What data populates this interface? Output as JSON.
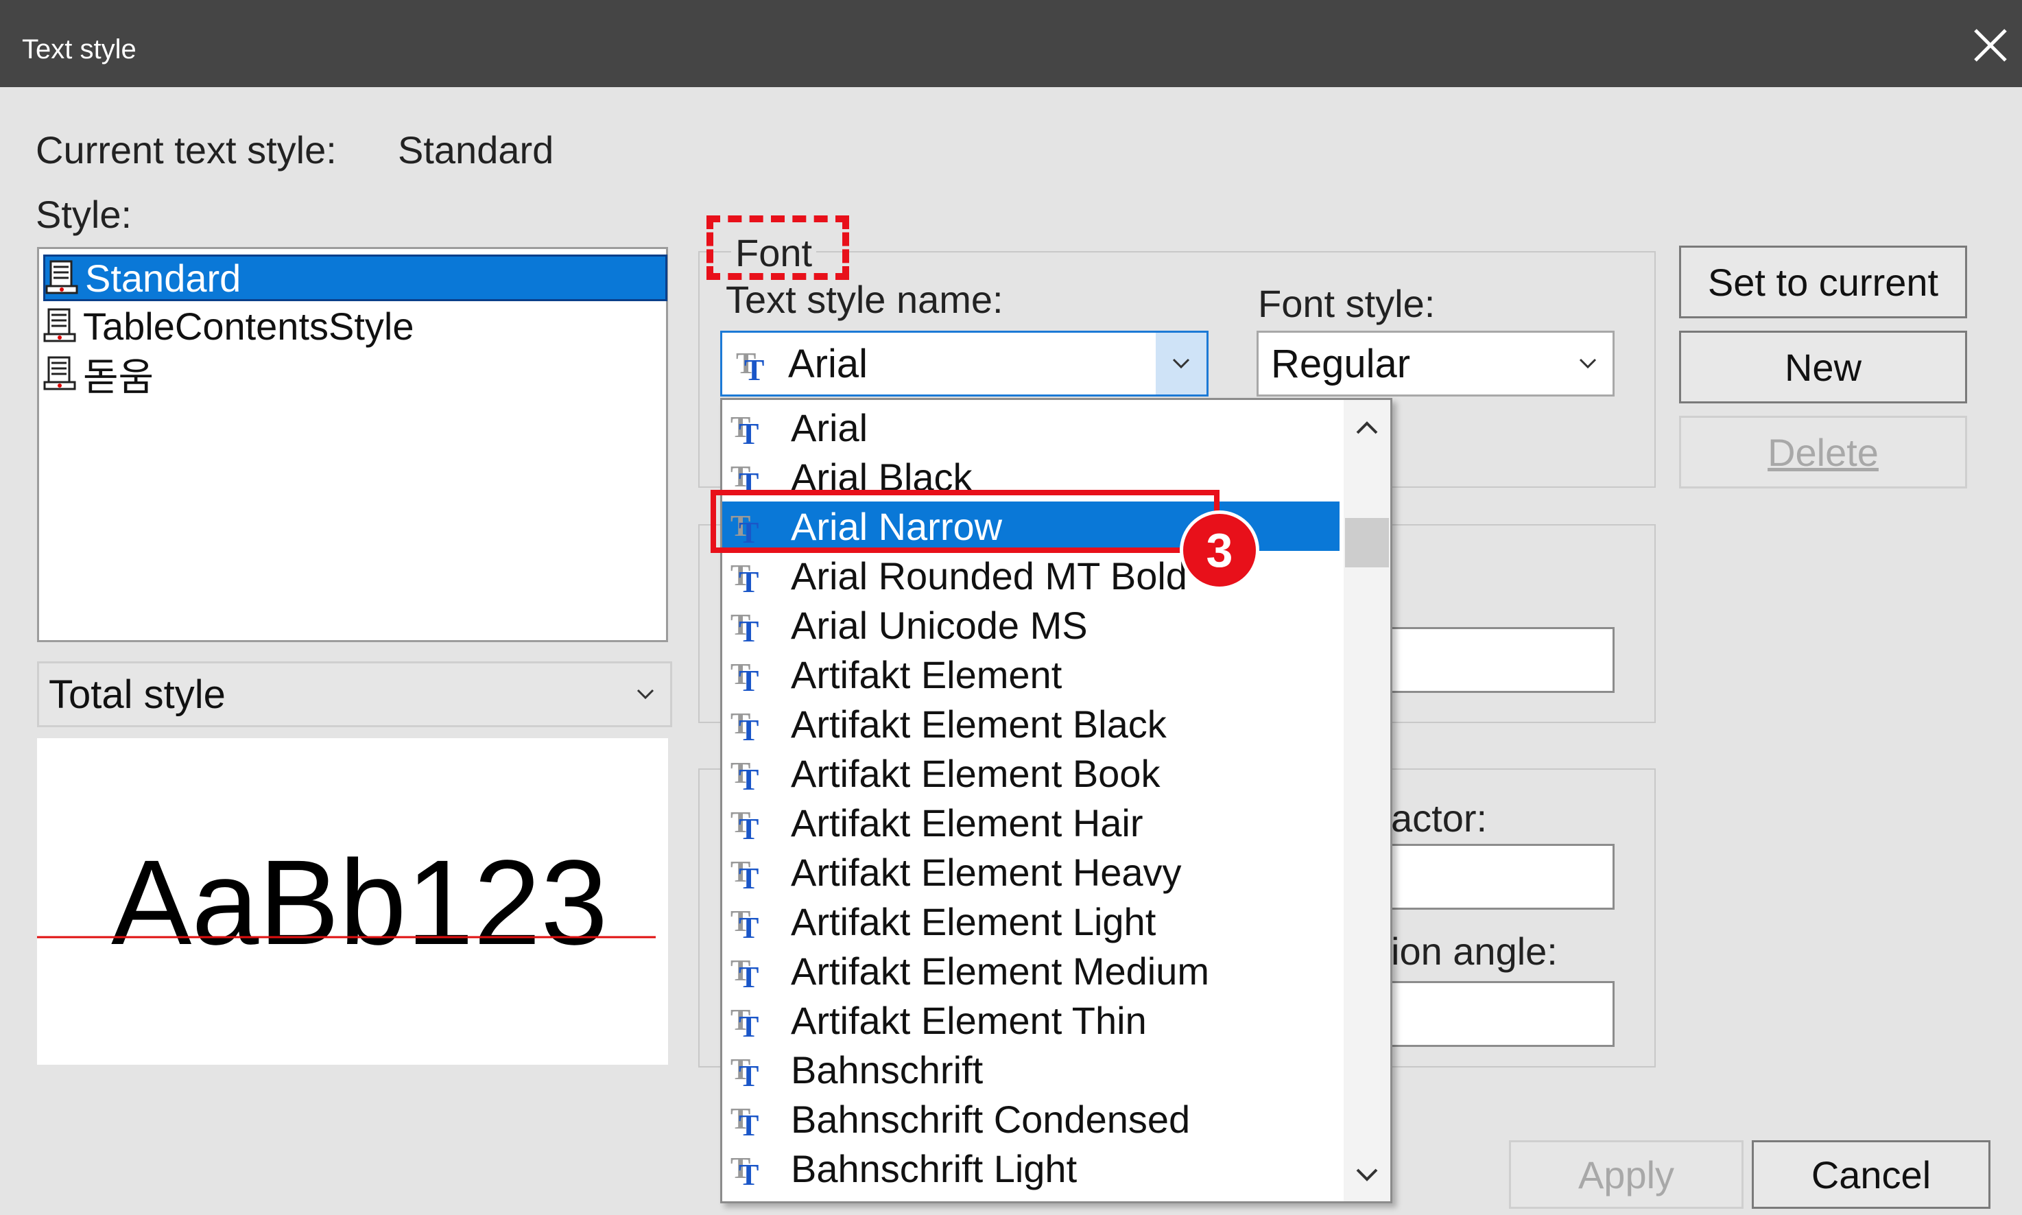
{
  "window": {
    "title": "Text style"
  },
  "current": {
    "label": "Current text style:",
    "value": "Standard"
  },
  "style_list": {
    "label": "Style:",
    "items": [
      {
        "label": "Standard",
        "selected": true
      },
      {
        "label": "TableContentsStyle",
        "selected": false
      },
      {
        "label": "돋움",
        "selected": false
      }
    ]
  },
  "filter": {
    "value": "Total style"
  },
  "preview": {
    "sample": "AaBb123"
  },
  "font_group": {
    "label": "Font",
    "name_label": "Text style name:",
    "name_value": "Arial",
    "style_label": "Font style:",
    "style_value": "Regular"
  },
  "partial_labels": {
    "factor": "actor:",
    "angle": "ion angle:"
  },
  "buttons": {
    "set_current": "Set to current",
    "new": "New",
    "delete": "Delete",
    "apply": "Apply",
    "cancel": "Cancel"
  },
  "dropdown": {
    "items": [
      "Arial",
      "Arial Black",
      "Arial Narrow",
      "Arial Rounded MT Bold",
      "Arial Unicode MS",
      "Artifakt Element",
      "Artifakt Element Black",
      "Artifakt Element Book",
      "Artifakt Element Hair",
      "Artifakt Element Heavy",
      "Artifakt Element Light",
      "Artifakt Element Medium",
      "Artifakt Element Thin",
      "Bahnschrift",
      "Bahnschrift Condensed",
      "Bahnschrift Light"
    ],
    "highlighted": "Arial Narrow"
  },
  "annotation": {
    "step": "3"
  },
  "colors": {
    "titlebar": "#454545",
    "selection": "#0a78d7",
    "annotation_red": "#e8101a",
    "icon_blue": "#1a56c8"
  },
  "icons": [
    "close-icon",
    "chevron-down-icon",
    "chevron-up-icon",
    "truetype-font-icon",
    "text-style-icon"
  ]
}
